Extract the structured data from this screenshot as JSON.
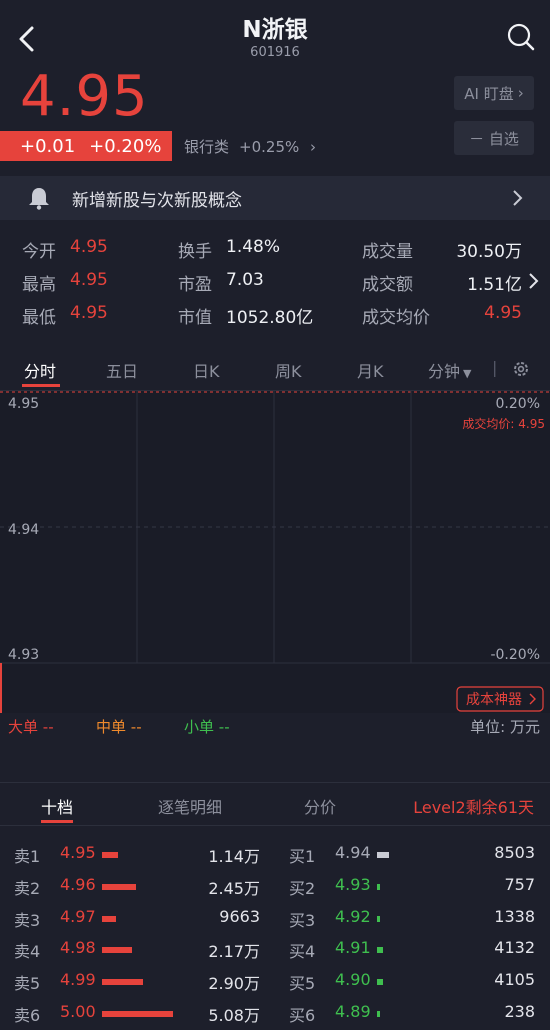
{
  "header": {
    "title": "N浙银",
    "code": "601916",
    "price": "4.95",
    "change": "+0.01",
    "change_pct": "+0.20%",
    "sector_name": "银行类",
    "sector_pct": "+0.25%",
    "ai_button": "AI 盯盘",
    "fav_button": "－ 自选"
  },
  "banner": {
    "text": "新增新股与次新股概念"
  },
  "stats": [
    [
      {
        "label": "今开",
        "value": "4.95",
        "color": "red"
      },
      {
        "label": "换手",
        "value": "1.48%",
        "color": "white"
      },
      {
        "label": "成交量",
        "value": "30.50万",
        "color": "white"
      }
    ],
    [
      {
        "label": "最高",
        "value": "4.95",
        "color": "red"
      },
      {
        "label": "市盈",
        "value": "7.03",
        "color": "white"
      },
      {
        "label": "成交额",
        "value": "1.51亿",
        "color": "white"
      }
    ],
    [
      {
        "label": "最低",
        "value": "4.95",
        "color": "red"
      },
      {
        "label": "市值",
        "value": "1052.80亿",
        "color": "white"
      },
      {
        "label": "成交均价",
        "value": "4.95",
        "color": "red"
      }
    ]
  ],
  "tabs": [
    "分时",
    "五日",
    "日K",
    "周K",
    "月K",
    "分钟"
  ],
  "chart": {
    "y_left": [
      "4.95",
      "4.94",
      "4.93"
    ],
    "y_right_top": "0.20%",
    "y_right_bottom": "-0.20%",
    "avg_label": "成交均价: 4.95",
    "cost_button": "成本神器"
  },
  "sizes": {
    "big": "大单",
    "big_val": "--",
    "mid": "中单",
    "mid_val": "--",
    "small": "小单",
    "small_val": "--",
    "unit": "单位: 万元"
  },
  "orderbook": {
    "tabs": [
      "十档",
      "逐笔明细",
      "分价"
    ],
    "level2": "Level2剩余61天",
    "sell": [
      {
        "label": "卖1",
        "price": "4.95",
        "vol": "1.14万",
        "size": 0.114
      },
      {
        "label": "卖2",
        "price": "4.96",
        "vol": "2.45万",
        "size": 0.245
      },
      {
        "label": "卖3",
        "price": "4.97",
        "vol": "9663",
        "size": 0.0966
      },
      {
        "label": "卖4",
        "price": "4.98",
        "vol": "2.17万",
        "size": 0.217
      },
      {
        "label": "卖5",
        "price": "4.99",
        "vol": "2.90万",
        "size": 0.29
      },
      {
        "label": "卖6",
        "price": "5.00",
        "vol": "5.08万",
        "size": 0.508
      }
    ],
    "buy": [
      {
        "label": "买1",
        "price": "4.94",
        "vol": "8503",
        "size": 0.085,
        "color": "gray"
      },
      {
        "label": "买2",
        "price": "4.93",
        "vol": "757",
        "size": 0.0076,
        "color": "green"
      },
      {
        "label": "买3",
        "price": "4.92",
        "vol": "1338",
        "size": 0.0134,
        "color": "green"
      },
      {
        "label": "买4",
        "price": "4.91",
        "vol": "4132",
        "size": 0.0413,
        "color": "green"
      },
      {
        "label": "买5",
        "price": "4.90",
        "vol": "4105",
        "size": 0.0411,
        "color": "green"
      },
      {
        "label": "买6",
        "price": "4.89",
        "vol": "238",
        "size": 0.0024,
        "color": "green"
      }
    ]
  },
  "colors": {
    "up": "#e6433c",
    "down": "#3fbf4f",
    "bg": "#1d1f2b"
  }
}
